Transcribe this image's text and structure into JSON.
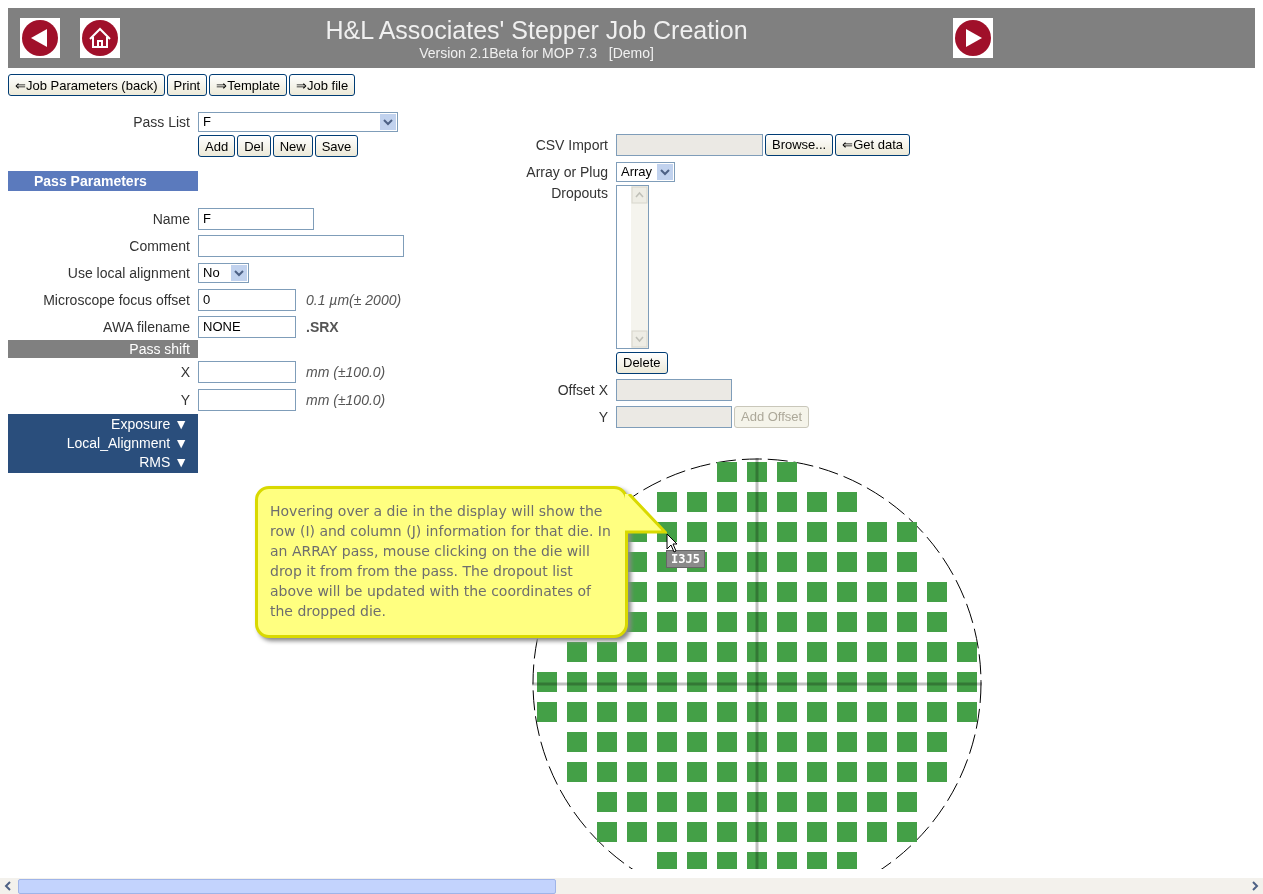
{
  "header": {
    "title": "H&L Associates' Stepper Job Creation",
    "subtitle": "Version 2.1Beta for MOP 7.3   [Demo]"
  },
  "toolbar": [
    "⇐Job Parameters (back)",
    "Print",
    "⇒Template",
    "⇒Job file"
  ],
  "pass_list": {
    "label": "Pass List",
    "value": "F",
    "buttons": [
      "Add",
      "Del",
      "New",
      "Save"
    ]
  },
  "pass_parameters": {
    "heading": "Pass Parameters",
    "fields": [
      {
        "kind": "text",
        "label": "Name",
        "value": "F"
      },
      {
        "kind": "wide_text",
        "label": "Comment"
      },
      {
        "kind": "select",
        "label": "Use local alignment",
        "value": "No"
      },
      {
        "kind": "short_text",
        "label": "Microscope focus offset",
        "value": "0",
        "note": "0.1 µm(± 2000)"
      },
      {
        "kind": "short_text",
        "label": "AWA filename",
        "value": "NONE",
        "extension": ".SRX"
      }
    ]
  },
  "pass_shift": {
    "heading": "Pass shift",
    "fields": [
      {
        "label": "X",
        "note": "mm (±100.0)"
      },
      {
        "label": "Y",
        "note": "mm (±100.0)"
      }
    ]
  },
  "sections": [
    {
      "label": "Exposure ▼"
    },
    {
      "label": "Local_Alignment ▼"
    },
    {
      "label": "RMS ▼"
    }
  ],
  "csv_import": {
    "label": "CSV Import",
    "buttons": [
      "Browse...",
      "⇐Get data"
    ]
  },
  "array_or_plug": {
    "label": "Array or Plug",
    "value": "Array"
  },
  "dropouts": {
    "label": "Dropouts",
    "delete_button": "Delete"
  },
  "offset": {
    "x_label": "Offset X",
    "y_label": "Y",
    "button": "Add Offset",
    "disabled": true
  },
  "wafer_map": {
    "hover_label": "I3J5",
    "callout": "Hovering over a die in the display will show the row (I) and column (J) information for that die. In an ARRAY pass, mouse clicking on the die will drop it from from the pass. The dropout list above will be updated with the coordinates of the dropped die."
  }
}
